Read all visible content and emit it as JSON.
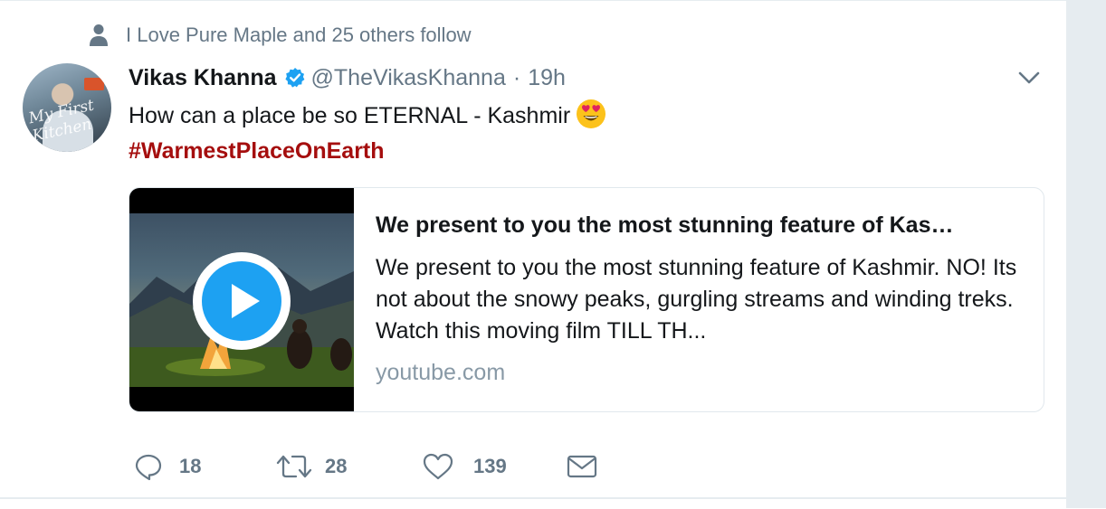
{
  "social_context": {
    "icon": "person-icon",
    "text": "I Love Pure Maple and 25 others follow"
  },
  "author": {
    "name": "Vikas Khanna",
    "verified": true,
    "handle": "@TheVikasKhanna",
    "separator": "·",
    "time": "19h",
    "avatar_text": "My First Kitchen"
  },
  "tweet": {
    "text": "How can a place be so ETERNAL - Kashmir",
    "emoji": "heart-eyes-emoji",
    "hashtag": "#WarmestPlaceOnEarth"
  },
  "card": {
    "title": "We present to you the most stunning feature of Kas…",
    "description": "We present to you the most stunning feature of Kashmir. NO! Its not about the snowy peaks, gurgling streams and winding treks. Watch this moving film TILL TH...",
    "domain": "youtube.com",
    "thumbnail": "video-thumbnail-campfire",
    "play_icon": "play-icon"
  },
  "actions": {
    "reply_count": "18",
    "retweet_count": "28",
    "like_count": "139"
  },
  "colors": {
    "hashtag": "#a50e0e",
    "secondary_text": "#657786",
    "verified": "#1da1f2",
    "play_button": "#1da1f2",
    "gutter": "#e6ecf0"
  }
}
